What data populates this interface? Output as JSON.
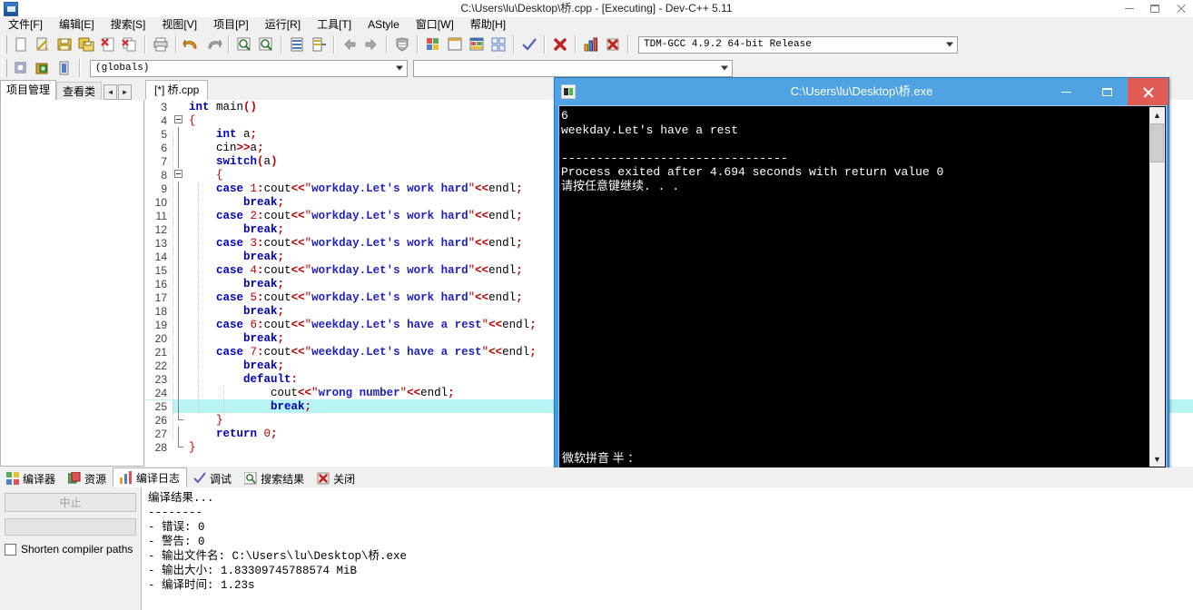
{
  "window": {
    "title": "C:\\Users\\lu\\Desktop\\桥.cpp - [Executing] - Dev-C++ 5.11",
    "minimize": "—",
    "maximize": "□",
    "close": "✕"
  },
  "menu": [
    {
      "label": "文件[F]"
    },
    {
      "label": "编辑[E]"
    },
    {
      "label": "搜索[S]"
    },
    {
      "label": "视图[V]"
    },
    {
      "label": "项目[P]"
    },
    {
      "label": "运行[R]"
    },
    {
      "label": "工具[T]"
    },
    {
      "label": "AStyle"
    },
    {
      "label": "窗口[W]"
    },
    {
      "label": "帮助[H]"
    }
  ],
  "toolbar": {
    "icons": [
      {
        "name": "new-file-icon"
      },
      {
        "name": "open-file-icon"
      },
      {
        "name": "save-icon"
      },
      {
        "name": "save-all-icon"
      },
      {
        "name": "close-file-icon"
      },
      {
        "name": "close-all-icon"
      },
      {
        "name": "print-icon"
      },
      {
        "name": "undo-icon"
      },
      {
        "name": "redo-icon"
      },
      {
        "name": "find-icon"
      },
      {
        "name": "find-next-icon"
      },
      {
        "name": "goto-line-icon"
      },
      {
        "name": "replace-icon"
      },
      {
        "name": "back-icon"
      },
      {
        "name": "forward-icon"
      },
      {
        "name": "shield-icon"
      },
      {
        "name": "compile-icon"
      },
      {
        "name": "run-icon"
      },
      {
        "name": "compile-run-icon"
      },
      {
        "name": "rebuild-all-icon"
      },
      {
        "name": "syntax-check-icon"
      },
      {
        "name": "stop-icon"
      },
      {
        "name": "profile-icon"
      },
      {
        "name": "debug-icon"
      }
    ],
    "compiler_combo": "TDM-GCC 4.9.2 64-bit Release",
    "scope_combo": "(globals)",
    "second_combo": ""
  },
  "left_tabs": {
    "items": [
      "项目管理",
      "查看类"
    ],
    "spin_prev": "◄",
    "spin_next": "►"
  },
  "editor": {
    "tab_label": "[*] 桥.cpp",
    "highlight_line": 25,
    "lines": [
      {
        "num": "3",
        "fold": "none",
        "indent": 0,
        "tokens": [
          {
            "t": "int ",
            "c": "k"
          },
          {
            "t": "main",
            "c": "id"
          },
          {
            "t": "()",
            "c": "p"
          }
        ]
      },
      {
        "num": "4",
        "fold": "start",
        "indent": 0,
        "tokens": [
          {
            "t": "{",
            "c": "br"
          }
        ]
      },
      {
        "num": "5",
        "fold": "bar",
        "indent": 1,
        "tokens": [
          {
            "t": "    ",
            "c": "id"
          },
          {
            "t": "int ",
            "c": "k"
          },
          {
            "t": "a",
            "c": "id"
          },
          {
            "t": ";",
            "c": "p"
          }
        ]
      },
      {
        "num": "6",
        "fold": "bar",
        "indent": 1,
        "tokens": [
          {
            "t": "    ",
            "c": "id"
          },
          {
            "t": "cin",
            "c": "id"
          },
          {
            "t": ">>",
            "c": "p"
          },
          {
            "t": "a",
            "c": "id"
          },
          {
            "t": ";",
            "c": "p"
          }
        ]
      },
      {
        "num": "7",
        "fold": "bar",
        "indent": 1,
        "tokens": [
          {
            "t": "    ",
            "c": "id"
          },
          {
            "t": "switch",
            "c": "k"
          },
          {
            "t": "(",
            "c": "p"
          },
          {
            "t": "a",
            "c": "id"
          },
          {
            "t": ")",
            "c": "p"
          }
        ]
      },
      {
        "num": "8",
        "fold": "start",
        "indent": 1,
        "tokens": [
          {
            "t": "    ",
            "c": "id"
          },
          {
            "t": "{",
            "c": "br"
          }
        ]
      },
      {
        "num": "9",
        "fold": "bar",
        "indent": 2,
        "tokens": [
          {
            "t": "    ",
            "c": "id"
          },
          {
            "t": "case ",
            "c": "k"
          },
          {
            "t": "1",
            "c": "n"
          },
          {
            "t": ":",
            "c": "p"
          },
          {
            "t": "cout",
            "c": "id"
          },
          {
            "t": "<<",
            "c": "p"
          },
          {
            "t": "\"workday.Let's work hard\"",
            "c": "s2"
          },
          {
            "t": "<<",
            "c": "p"
          },
          {
            "t": "endl",
            "c": "id"
          },
          {
            "t": ";",
            "c": "p"
          }
        ]
      },
      {
        "num": "10",
        "fold": "bar",
        "indent": 2,
        "tokens": [
          {
            "t": "        ",
            "c": "id"
          },
          {
            "t": "break",
            "c": "k"
          },
          {
            "t": ";",
            "c": "p"
          }
        ]
      },
      {
        "num": "11",
        "fold": "bar",
        "indent": 2,
        "tokens": [
          {
            "t": "    ",
            "c": "id"
          },
          {
            "t": "case ",
            "c": "k"
          },
          {
            "t": "2",
            "c": "n"
          },
          {
            "t": ":",
            "c": "p"
          },
          {
            "t": "cout",
            "c": "id"
          },
          {
            "t": "<<",
            "c": "p"
          },
          {
            "t": "\"workday.Let's work hard\"",
            "c": "s2"
          },
          {
            "t": "<<",
            "c": "p"
          },
          {
            "t": "endl",
            "c": "id"
          },
          {
            "t": ";",
            "c": "p"
          }
        ]
      },
      {
        "num": "12",
        "fold": "bar",
        "indent": 2,
        "tokens": [
          {
            "t": "        ",
            "c": "id"
          },
          {
            "t": "break",
            "c": "k"
          },
          {
            "t": ";",
            "c": "p"
          }
        ]
      },
      {
        "num": "13",
        "fold": "bar",
        "indent": 2,
        "tokens": [
          {
            "t": "    ",
            "c": "id"
          },
          {
            "t": "case ",
            "c": "k"
          },
          {
            "t": "3",
            "c": "n"
          },
          {
            "t": ":",
            "c": "p"
          },
          {
            "t": "cout",
            "c": "id"
          },
          {
            "t": "<<",
            "c": "p"
          },
          {
            "t": "\"workday.Let's work hard\"",
            "c": "s2"
          },
          {
            "t": "<<",
            "c": "p"
          },
          {
            "t": "endl",
            "c": "id"
          },
          {
            "t": ";",
            "c": "p"
          }
        ]
      },
      {
        "num": "14",
        "fold": "bar",
        "indent": 2,
        "tokens": [
          {
            "t": "        ",
            "c": "id"
          },
          {
            "t": "break",
            "c": "k"
          },
          {
            "t": ";",
            "c": "p"
          }
        ]
      },
      {
        "num": "15",
        "fold": "bar",
        "indent": 2,
        "tokens": [
          {
            "t": "    ",
            "c": "id"
          },
          {
            "t": "case ",
            "c": "k"
          },
          {
            "t": "4",
            "c": "n"
          },
          {
            "t": ":",
            "c": "p"
          },
          {
            "t": "cout",
            "c": "id"
          },
          {
            "t": "<<",
            "c": "p"
          },
          {
            "t": "\"workday.Let's work hard\"",
            "c": "s2"
          },
          {
            "t": "<<",
            "c": "p"
          },
          {
            "t": "endl",
            "c": "id"
          },
          {
            "t": ";",
            "c": "p"
          }
        ]
      },
      {
        "num": "16",
        "fold": "bar",
        "indent": 2,
        "tokens": [
          {
            "t": "        ",
            "c": "id"
          },
          {
            "t": "break",
            "c": "k"
          },
          {
            "t": ";",
            "c": "p"
          }
        ]
      },
      {
        "num": "17",
        "fold": "bar",
        "indent": 2,
        "tokens": [
          {
            "t": "    ",
            "c": "id"
          },
          {
            "t": "case ",
            "c": "k"
          },
          {
            "t": "5",
            "c": "n"
          },
          {
            "t": ":",
            "c": "p"
          },
          {
            "t": "cout",
            "c": "id"
          },
          {
            "t": "<<",
            "c": "p"
          },
          {
            "t": "\"workday.Let's work hard\"",
            "c": "s2"
          },
          {
            "t": "<<",
            "c": "p"
          },
          {
            "t": "endl",
            "c": "id"
          },
          {
            "t": ";",
            "c": "p"
          }
        ]
      },
      {
        "num": "18",
        "fold": "bar",
        "indent": 2,
        "tokens": [
          {
            "t": "        ",
            "c": "id"
          },
          {
            "t": "break",
            "c": "k"
          },
          {
            "t": ";",
            "c": "p"
          }
        ]
      },
      {
        "num": "19",
        "fold": "bar",
        "indent": 2,
        "tokens": [
          {
            "t": "    ",
            "c": "id"
          },
          {
            "t": "case ",
            "c": "k"
          },
          {
            "t": "6",
            "c": "n"
          },
          {
            "t": ":",
            "c": "p"
          },
          {
            "t": "cout",
            "c": "id"
          },
          {
            "t": "<<",
            "c": "p"
          },
          {
            "t": "\"weekday.Let's have a rest\"",
            "c": "s2"
          },
          {
            "t": "<<",
            "c": "p"
          },
          {
            "t": "endl",
            "c": "id"
          },
          {
            "t": ";",
            "c": "p"
          }
        ]
      },
      {
        "num": "20",
        "fold": "bar",
        "indent": 2,
        "tokens": [
          {
            "t": "        ",
            "c": "id"
          },
          {
            "t": "break",
            "c": "k"
          },
          {
            "t": ";",
            "c": "p"
          }
        ]
      },
      {
        "num": "21",
        "fold": "bar",
        "indent": 2,
        "tokens": [
          {
            "t": "    ",
            "c": "id"
          },
          {
            "t": "case ",
            "c": "k"
          },
          {
            "t": "7",
            "c": "n"
          },
          {
            "t": ":",
            "c": "p"
          },
          {
            "t": "cout",
            "c": "id"
          },
          {
            "t": "<<",
            "c": "p"
          },
          {
            "t": "\"weekday.Let's have a rest\"",
            "c": "s2"
          },
          {
            "t": "<<",
            "c": "p"
          },
          {
            "t": "endl",
            "c": "id"
          },
          {
            "t": ";",
            "c": "p"
          }
        ]
      },
      {
        "num": "22",
        "fold": "bar",
        "indent": 2,
        "tokens": [
          {
            "t": "        ",
            "c": "id"
          },
          {
            "t": "break",
            "c": "k"
          },
          {
            "t": ";",
            "c": "p"
          }
        ]
      },
      {
        "num": "23",
        "fold": "bar",
        "indent": 2,
        "tokens": [
          {
            "t": "        ",
            "c": "id"
          },
          {
            "t": "default",
            "c": "k"
          },
          {
            "t": ":",
            "c": "p"
          }
        ]
      },
      {
        "num": "24",
        "fold": "bar",
        "indent": 3,
        "tokens": [
          {
            "t": "            ",
            "c": "id"
          },
          {
            "t": "cout",
            "c": "id"
          },
          {
            "t": "<<",
            "c": "p"
          },
          {
            "t": "\"wrong number\"",
            "c": "s2"
          },
          {
            "t": "<<",
            "c": "p"
          },
          {
            "t": "endl",
            "c": "id"
          },
          {
            "t": ";",
            "c": "p"
          }
        ]
      },
      {
        "num": "25",
        "fold": "bar",
        "indent": 3,
        "tokens": [
          {
            "t": "            ",
            "c": "id"
          },
          {
            "t": "break",
            "c": "k"
          },
          {
            "t": ";",
            "c": "p"
          }
        ]
      },
      {
        "num": "26",
        "fold": "end",
        "indent": 1,
        "tokens": [
          {
            "t": "    ",
            "c": "id"
          },
          {
            "t": "}",
            "c": "br"
          }
        ]
      },
      {
        "num": "27",
        "fold": "bar2",
        "indent": 1,
        "tokens": [
          {
            "t": "    ",
            "c": "id"
          },
          {
            "t": "return ",
            "c": "k"
          },
          {
            "t": "0",
            "c": "n"
          },
          {
            "t": ";",
            "c": "p"
          }
        ]
      },
      {
        "num": "28",
        "fold": "end2",
        "indent": 0,
        "tokens": [
          {
            "t": "}",
            "c": "br"
          }
        ]
      }
    ]
  },
  "console": {
    "title": "C:\\Users\\lu\\Desktop\\桥.exe",
    "minimize": "—",
    "maximize": "□",
    "close": "✕",
    "output": "6\nweekday.Let's have a rest\n\n--------------------------------\nProcess exited after 4.694 seconds with return value 0\n请按任意键继续. . .",
    "ime_status": "微软拼音 半 ："
  },
  "bottom_tabs": [
    {
      "label": "编译器",
      "icon": "compiler-icon",
      "active": false
    },
    {
      "label": "资源",
      "icon": "resource-icon",
      "active": false
    },
    {
      "label": "编译日志",
      "icon": "log-icon",
      "active": true
    },
    {
      "label": "调试",
      "icon": "debug-check-icon",
      "active": false
    },
    {
      "label": "搜索结果",
      "icon": "search-result-icon",
      "active": false
    },
    {
      "label": "关闭",
      "icon": "close-panel-icon",
      "active": false
    }
  ],
  "bottom_panel": {
    "abort_button": "中止",
    "shorten_checkbox": "Shorten compiler paths",
    "log_lines": [
      "编译结果...",
      "--------",
      "- 错误: 0",
      "- 警告: 0",
      "- 输出文件名: C:\\Users\\lu\\Desktop\\桥.exe",
      "- 输出大小: 1.83309745788574 MiB",
      "- 编译时间: 1.23s"
    ]
  },
  "colors": {
    "console_titlebar": "#4fa3e3",
    "console_close": "#e05b52",
    "editor_highlight": "#b8f4f4",
    "keyword": "#0000c0",
    "string": "#c00000",
    "chrome": "#f0f0f0"
  }
}
